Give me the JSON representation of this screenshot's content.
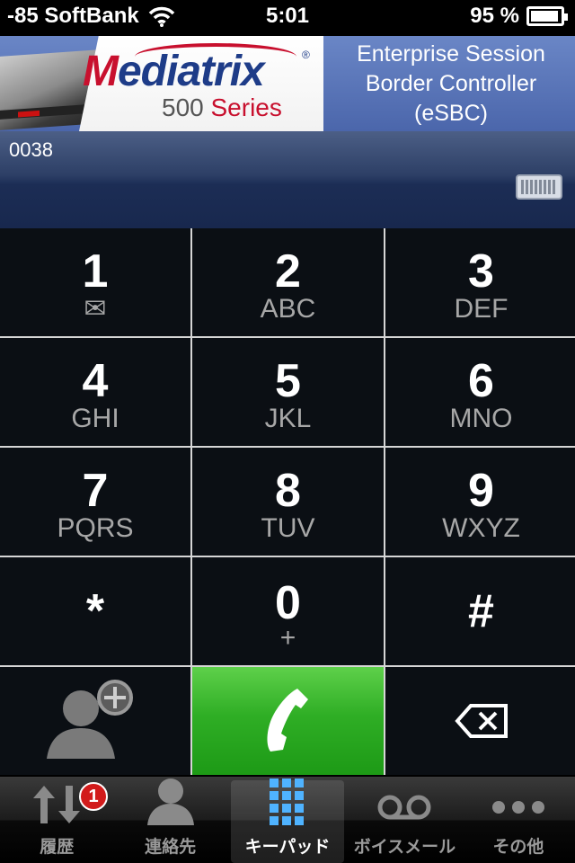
{
  "status_bar": {
    "signal": "-85 SoftBank",
    "time": "5:01",
    "battery": "95 %"
  },
  "banner": {
    "logo_letter": "M",
    "logo_rest": "ediatrix",
    "logo_registered": "®",
    "series_number": "500",
    "series_word": "Series",
    "product_line1": "Enterprise Session",
    "product_line2": "Border Controller",
    "product_line3": "(eSBC)"
  },
  "display": {
    "number": "0038"
  },
  "keypad": {
    "keys": [
      {
        "digit": "1",
        "letters": "✉"
      },
      {
        "digit": "2",
        "letters": "ABC"
      },
      {
        "digit": "3",
        "letters": "DEF"
      },
      {
        "digit": "4",
        "letters": "GHI"
      },
      {
        "digit": "5",
        "letters": "JKL"
      },
      {
        "digit": "6",
        "letters": "MNO"
      },
      {
        "digit": "7",
        "letters": "PQRS"
      },
      {
        "digit": "8",
        "letters": "TUV"
      },
      {
        "digit": "9",
        "letters": "WXYZ"
      },
      {
        "digit": "*",
        "letters": ""
      },
      {
        "digit": "0",
        "letters": "+"
      },
      {
        "digit": "#",
        "letters": ""
      }
    ],
    "icons": {
      "add_contact": "add-contact-icon",
      "call": "phone-icon",
      "delete": "backspace-icon"
    },
    "call_color": "#2fae25"
  },
  "tab_bar": {
    "tabs": [
      {
        "label": "履歴",
        "icon": "history-icon",
        "badge": "1"
      },
      {
        "label": "連絡先",
        "icon": "contacts-icon"
      },
      {
        "label": "キーパッド",
        "icon": "keypad-icon"
      },
      {
        "label": "ボイスメール",
        "icon": "voicemail-icon"
      },
      {
        "label": "その他",
        "icon": "more-icon"
      }
    ],
    "active": "キーパッド"
  }
}
